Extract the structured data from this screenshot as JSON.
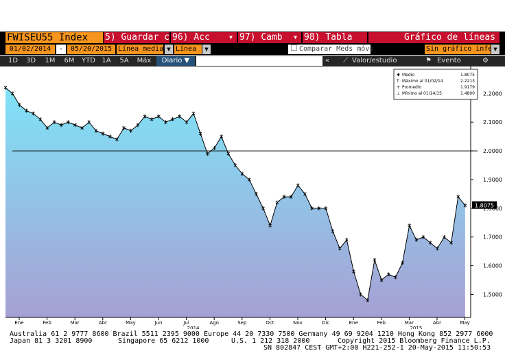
{
  "toolbar": {
    "ticker": "FWISEU55 Index",
    "save": "Guardar c/.",
    "save_num": "5)",
    "actions": "Acc",
    "actions_num": "96)",
    "change": "Camb",
    "change_num": "97)",
    "table": "Tabla",
    "table_num": "98)",
    "chart_title": "Gráfico de líneas"
  },
  "params": {
    "date_from": "01/02/2014",
    "dash": "-",
    "date_to": "05/20/2015",
    "mode": "Línea media",
    "style": "Línea",
    "compare": "Comparar Meds móvs",
    "lower_chart": "Sin gráfico inferio"
  },
  "periods": {
    "tabs": [
      "1D",
      "3D",
      "1M",
      "6M",
      "YTD",
      "1A",
      "5A",
      "Máx"
    ],
    "frequency": "Diario ▼",
    "value_study": "Valor/estudio",
    "event": "Evento",
    "collapse": "«"
  },
  "colors": {
    "accent_orange": "#f7941d",
    "action_red": "#c8102e",
    "fill_top": "#7fe3f7",
    "fill_bottom": "#a7a0d4",
    "line": "#000000"
  },
  "legend": {
    "items": [
      {
        "label": "Medio",
        "value": "1.8075"
      },
      {
        "label": "Máximo al 01/02/14",
        "value": "2.2213"
      },
      {
        "label": "Promedio",
        "value": "1.9179"
      },
      {
        "label": "Mínimo al 01/14/15",
        "value": "1.4800"
      }
    ]
  },
  "chart_data": {
    "type": "area",
    "title": "",
    "xlabel": "",
    "ylabel": "",
    "ylim": [
      1.42,
      2.27
    ],
    "grid": false,
    "legend_position": "top-right",
    "y_ticks": [
      "2.2000",
      "2.1000",
      "2.0000",
      "1.9000",
      "1.8000",
      "1.7000",
      "1.6000",
      "1.5000"
    ],
    "y_tick_values": [
      2.2,
      2.1,
      2.0,
      1.9,
      1.8,
      1.7,
      1.6,
      1.5
    ],
    "x_ticks": [
      "Ene",
      "Feb",
      "Mar",
      "Abr",
      "May",
      "Jun",
      "Jul",
      "Ago",
      "Sep",
      "Oct",
      "Nov",
      "Dic",
      "Ene",
      "Feb",
      "Mar",
      "Abr",
      "May"
    ],
    "x_tick_positions": [
      0.0,
      1.0,
      2.0,
      3.0,
      4.0,
      5.0,
      6.0,
      7.0,
      8.0,
      9.0,
      10.0,
      11.0,
      12.0,
      13.0,
      14.0,
      15.0,
      16.0
    ],
    "x_max": 16.7,
    "year_labels": [
      {
        "label": "2014",
        "x": 6.0
      },
      {
        "label": "2015",
        "x": 14.0
      }
    ],
    "last_value_label": "1.8075",
    "reference_line": 2.0,
    "x": [
      0.0,
      0.25,
      0.5,
      0.75,
      1.0,
      1.25,
      1.5,
      1.75,
      2.0,
      2.25,
      2.5,
      2.75,
      3.0,
      3.25,
      3.5,
      3.75,
      4.0,
      4.25,
      4.5,
      4.75,
      5.0,
      5.25,
      5.5,
      5.75,
      6.0,
      6.25,
      6.5,
      6.75,
      7.0,
      7.25,
      7.5,
      7.75,
      8.0,
      8.25,
      8.5,
      8.75,
      9.0,
      9.25,
      9.5,
      9.75,
      10.0,
      10.25,
      10.5,
      10.75,
      11.0,
      11.25,
      11.5,
      11.75,
      12.0,
      12.25,
      12.5,
      12.75,
      13.0,
      13.25,
      13.5,
      13.75,
      14.0,
      14.25,
      14.5,
      14.75,
      15.0,
      15.25,
      15.5,
      15.75,
      16.0,
      16.25,
      16.5
    ],
    "values": [
      2.22,
      2.2,
      2.16,
      2.14,
      2.13,
      2.11,
      2.08,
      2.1,
      2.09,
      2.1,
      2.09,
      2.08,
      2.1,
      2.07,
      2.06,
      2.05,
      2.04,
      2.08,
      2.07,
      2.09,
      2.12,
      2.11,
      2.12,
      2.1,
      2.11,
      2.12,
      2.1,
      2.13,
      2.06,
      1.99,
      2.01,
      2.05,
      1.99,
      1.95,
      1.92,
      1.9,
      1.85,
      1.8,
      1.74,
      1.82,
      1.84,
      1.84,
      1.88,
      1.85,
      1.8,
      1.8,
      1.8,
      1.72,
      1.66,
      1.69,
      1.58,
      1.5,
      1.48,
      1.62,
      1.55,
      1.57,
      1.56,
      1.61,
      1.74,
      1.69,
      1.7,
      1.68,
      1.66,
      1.7,
      1.68,
      1.84,
      1.81
    ]
  },
  "footer": {
    "line1": "Australia 61 2 9777 8600 Brazil 5511 2395 9000 Europe 44 20 7330 7500 Germany 49 69 9204 1210 Hong Kong 852 2977 6000",
    "line2a": "Japan 81 3 3201 8900",
    "line2b": "Singapore 65 6212 1000",
    "line2c": "U.S. 1 212 318 2000",
    "line2d": "Copyright 2015 Bloomberg Finance L.P.",
    "line3": "SN 802847 CEST GMT+2:00 H221-252-1 20-May-2015 11:50:53"
  }
}
